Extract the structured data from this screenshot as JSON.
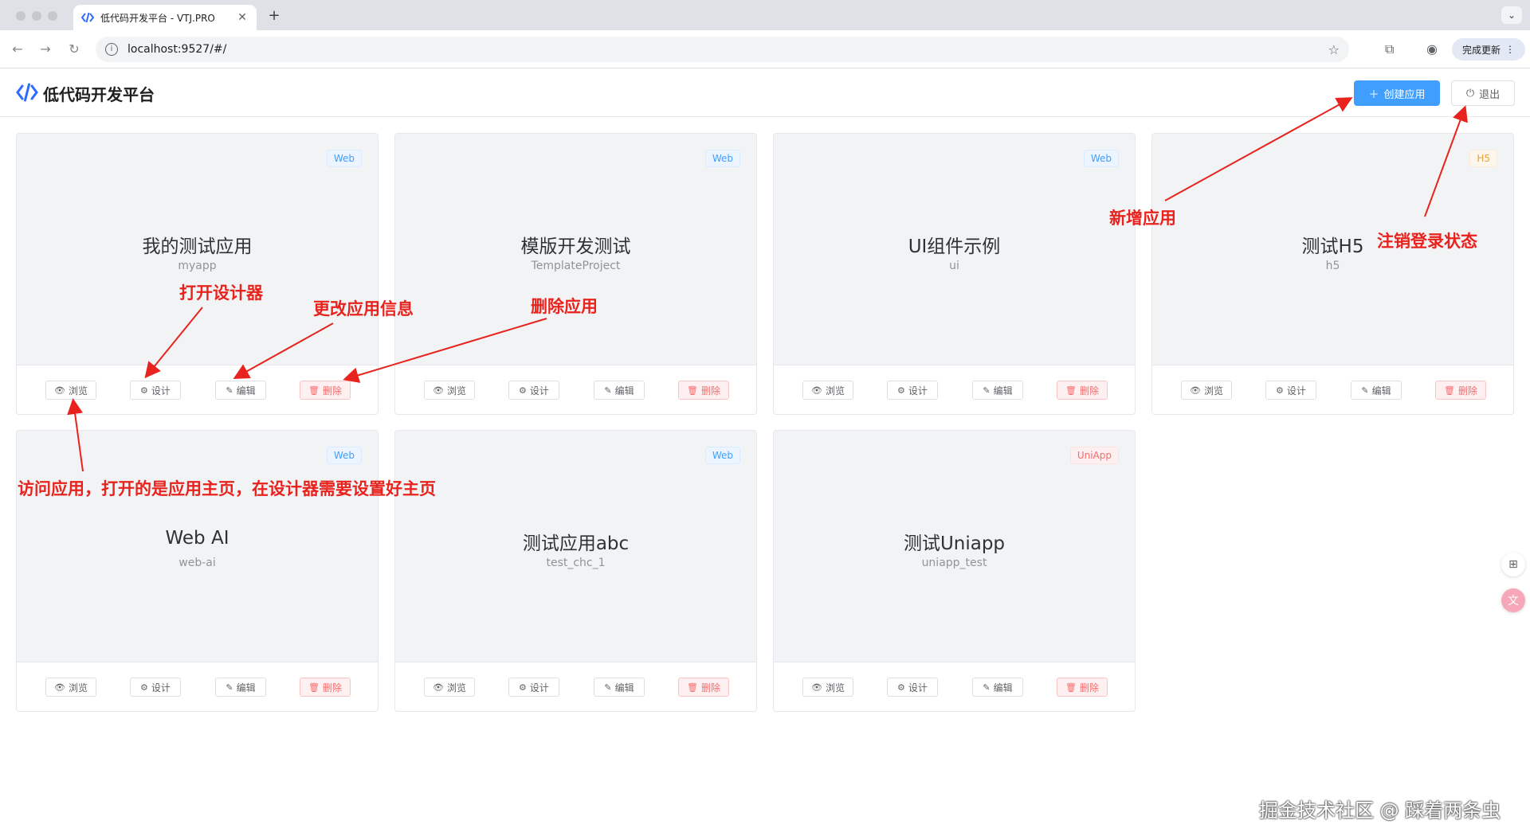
{
  "browser": {
    "tab_title": "低代码开发平台 - VTJ.PRO",
    "url": "localhost:9527/#/",
    "update_label": "完成更新"
  },
  "app": {
    "logo_text": "低代码开发平台",
    "create_label": "创建应用",
    "logout_label": "退出"
  },
  "actions": {
    "browse": "浏览",
    "design": "设计",
    "edit": "编辑",
    "delete": "删除"
  },
  "cards": [
    {
      "name": "我的测试应用",
      "code": "myapp",
      "tag": "Web"
    },
    {
      "name": "模版开发测试",
      "code": "TemplateProject",
      "tag": "Web"
    },
    {
      "name": "UI组件示例",
      "code": "ui",
      "tag": "Web"
    },
    {
      "name": "测试H5",
      "code": "h5",
      "tag": "H5"
    },
    {
      "name": "Web AI",
      "code": "web-ai",
      "tag": "Web"
    },
    {
      "name": "测试应用abc",
      "code": "test_chc_1",
      "tag": "Web"
    },
    {
      "name": "测试Uniapp",
      "code": "uniapp_test",
      "tag": "UniApp"
    }
  ],
  "annotations": {
    "open_designer": "打开设计器",
    "edit_info": "更改应用信息",
    "delete_app": "删除应用",
    "new_app": "新增应用",
    "logout_state": "注销登录状态",
    "visit_app": "访问应用，打开的是应用主页，在设计器需要设置好主页"
  },
  "watermark": "掘金技术社区 @ 踩着两条虫",
  "colors": {
    "primary": "#409eff",
    "danger": "#f56c6c",
    "warning": "#e6a23c",
    "annotation": "#e8231d"
  }
}
